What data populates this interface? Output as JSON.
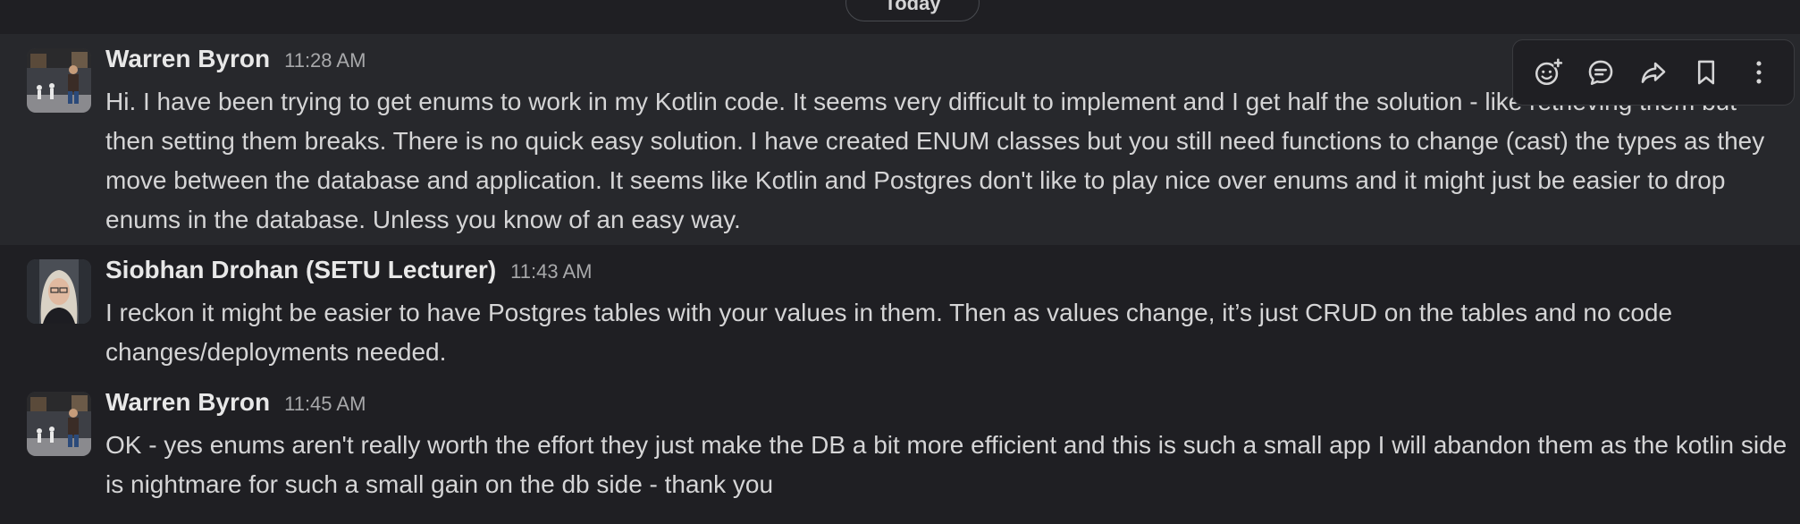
{
  "divider": {
    "label": "Today"
  },
  "messages": [
    {
      "author": "Warren Byron",
      "time": "11:28 AM",
      "text": "Hi.  I have been trying to get enums to work in my Kotlin code.  It seems very difficult to implement and I get half the solution - like retrieving them but then setting them breaks.   There is no quick easy solution.  I have created ENUM classes but you still need functions to change (cast) the types as they move between the database and application.  It seems like Kotlin and Postgres don't like to play nice over enums and it might just be easier to drop enums in the database.   Unless you know of an easy way."
    },
    {
      "author": "Siobhan Drohan (SETU Lecturer)",
      "time": "11:43 AM",
      "text": "I reckon it might be easier to have Postgres tables with your values in them.  Then as values change, it’s just CRUD on the tables and no code changes/deployments needed."
    },
    {
      "author": "Warren Byron",
      "time": "11:45 AM",
      "text": "OK - yes enums aren't really worth the effort they just make the DB a bit more efficient and this is such a small app I will abandon them as the kotlin side is nightmare for such a small gain on the db side - thank you"
    }
  ],
  "toolbar": {
    "icons": [
      "add-reaction-icon",
      "reply-in-thread-icon",
      "share-message-icon",
      "save-bookmark-icon",
      "more-actions-icon"
    ]
  },
  "colors": {
    "background": "#1f1f23",
    "hover_row": "#27282c",
    "text": "#d5d5d6",
    "muted": "#a8a9ab"
  }
}
